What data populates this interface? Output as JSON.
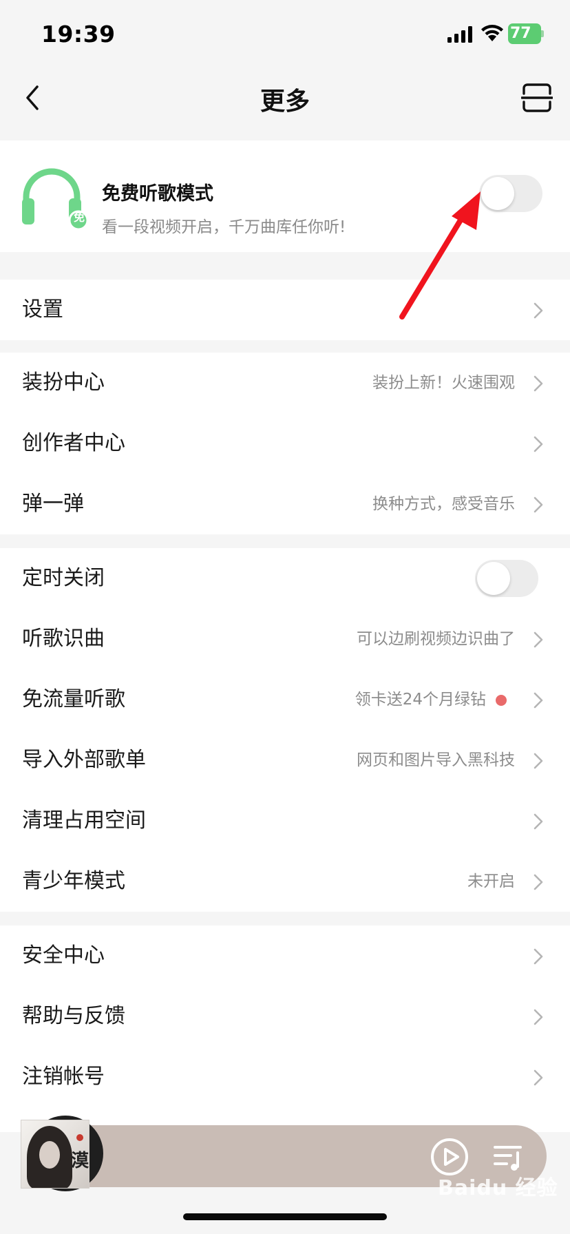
{
  "status_bar": {
    "time": "19:39",
    "battery": "77"
  },
  "header": {
    "title": "更多",
    "back_icon": "back-chevron-icon",
    "scan_icon": "scan-icon"
  },
  "free_mode": {
    "title": "免费听歌模式",
    "subtitle": "看一段视频开启，千万曲库任你听!",
    "badge": "免",
    "toggle_on": false,
    "icon_color": "#6ed68a"
  },
  "settings_group": [
    {
      "label": "设置"
    }
  ],
  "personal_group": [
    {
      "label": "装扮中心",
      "value": "装扮上新！火速围观"
    },
    {
      "label": "创作者中心",
      "value": ""
    },
    {
      "label": "弹一弹",
      "value": "换种方式，感受音乐"
    }
  ],
  "tools_group": {
    "timer": {
      "label": "定时关闭",
      "toggle_on": false
    },
    "items": [
      {
        "label": "听歌识曲",
        "value": "可以边刷视频边识曲了"
      },
      {
        "label": "免流量听歌",
        "value": "领卡送24个月绿钻",
        "dot_color": "#e96a6a"
      },
      {
        "label": "导入外部歌单",
        "value": "网页和图片导入黑科技"
      },
      {
        "label": "清理占用空间",
        "value": ""
      },
      {
        "label": "青少年模式",
        "value": "未开启"
      }
    ]
  },
  "account_group": [
    {
      "label": "安全中心"
    },
    {
      "label": "帮助与反馈"
    },
    {
      "label": "注销帐号"
    }
  ],
  "mini_player": {
    "cover_char": "漠",
    "play_icon": "play-icon",
    "playlist_icon": "playlist-icon"
  },
  "watermark": "Baidu 经验",
  "colors": {
    "accent_green": "#6ed68a",
    "annotation_red": "#f0141e",
    "player_bg": "#c9bcb5"
  }
}
